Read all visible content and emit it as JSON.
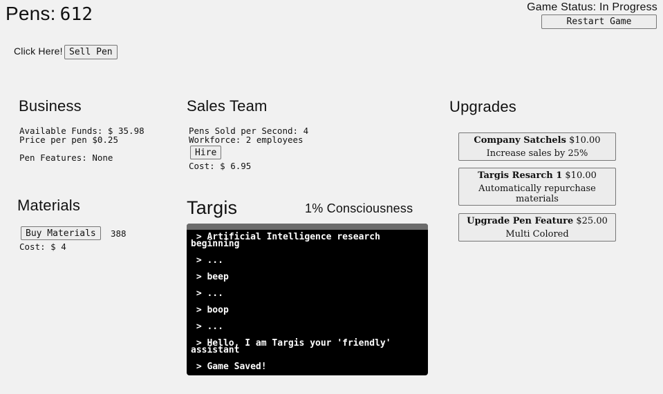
{
  "header": {
    "pens_label": "Pens:",
    "pens_count": "612",
    "status_text": "Game Status: In Progress",
    "restart_label": "Restart Game"
  },
  "click": {
    "label": "Click Here!",
    "sell_label": "Sell Pen"
  },
  "business": {
    "title": "Business",
    "funds": "Available Funds: $ 35.98",
    "price": "Price per pen $0.25",
    "features": "Pen Features: None"
  },
  "sales": {
    "title": "Sales Team",
    "per_second": "Pens Sold per Second: 4",
    "workforce": "Workforce: 2 employees",
    "hire_label": "Hire",
    "cost": "Cost: $ 6.95"
  },
  "materials": {
    "title": "Materials",
    "buy_label": "Buy Materials",
    "count": "388",
    "cost": "Cost: $ 4"
  },
  "targis": {
    "title": "Targis",
    "consciousness": "1% Consciousness",
    "lines": [
      " > Artificial Intelligence research beginning",
      " > ...",
      " > beep",
      " > ...",
      " > boop",
      " > ...",
      " > Hello, I am Targis your 'friendly' assistant",
      " > Game Saved!"
    ]
  },
  "upgrades": {
    "title": "Upgrades",
    "items": [
      {
        "name": "Company Satchels",
        "price": "$10.00",
        "desc": "Increase sales by 25%"
      },
      {
        "name": "Targis Resarch 1",
        "price": "$10.00",
        "desc": "Automatically repurchase materials"
      },
      {
        "name": "Upgrade Pen Feature",
        "price": "$25.00",
        "desc": "Multi Colored"
      }
    ]
  }
}
